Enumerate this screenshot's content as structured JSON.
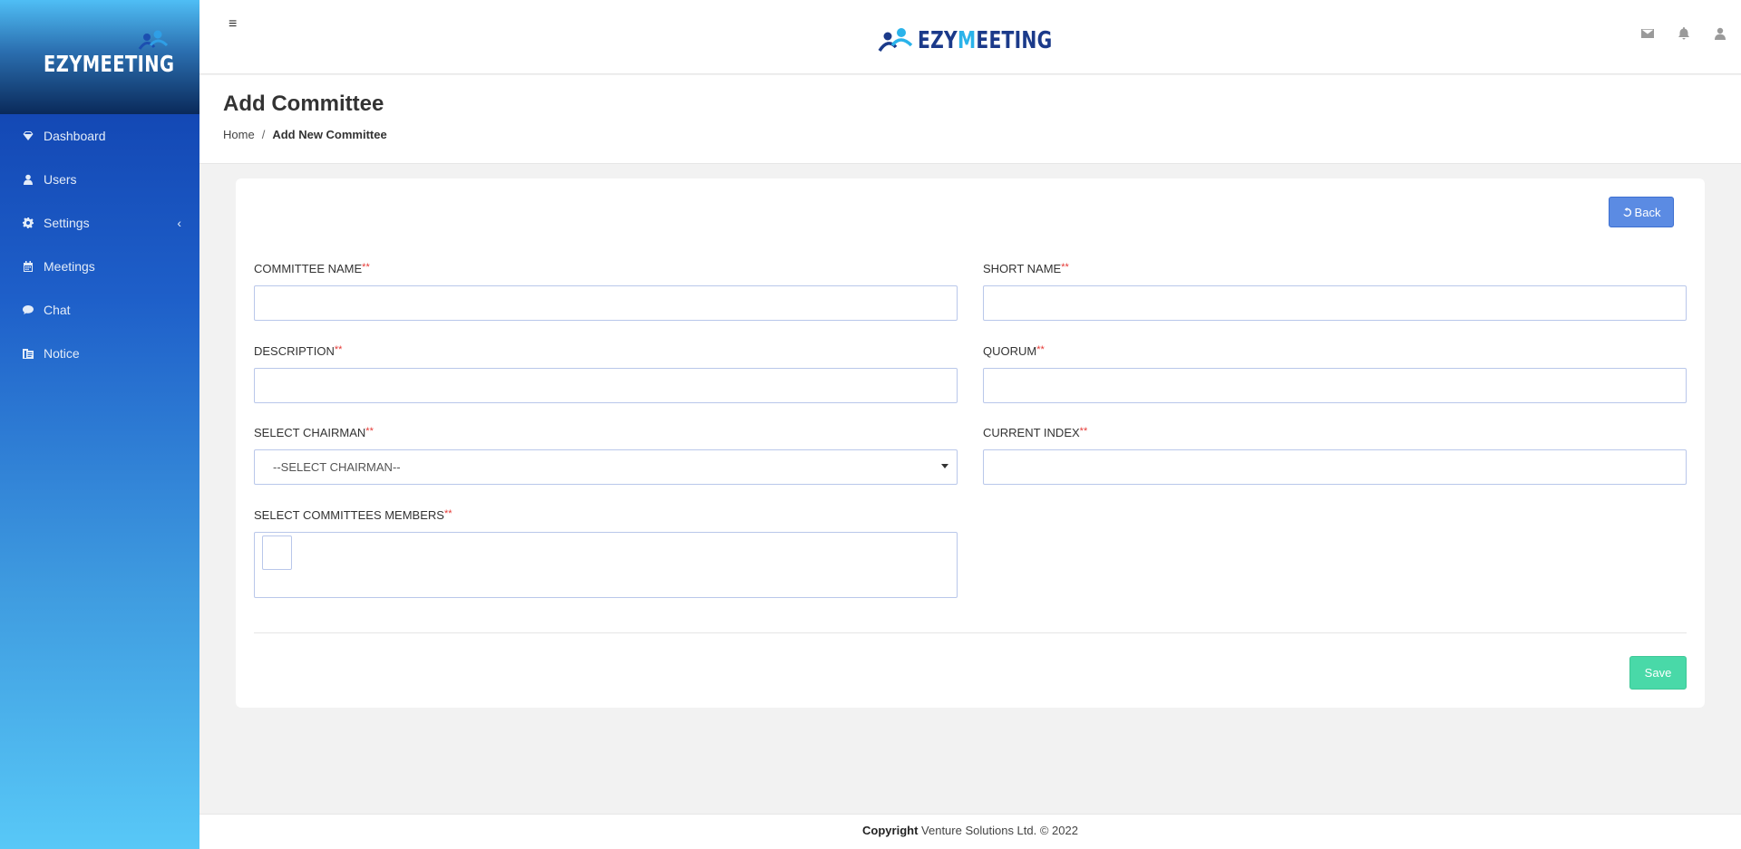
{
  "sidebar": {
    "brand": "EZYMEETING",
    "items": [
      {
        "label": "Dashboard",
        "icon": "diamond-icon"
      },
      {
        "label": "Users",
        "icon": "user-icon"
      },
      {
        "label": "Settings",
        "icon": "gear-icon"
      },
      {
        "label": "Meetings",
        "icon": "calendar-icon"
      },
      {
        "label": "Chat",
        "icon": "chat-icon"
      },
      {
        "label": "Notice",
        "icon": "notice-icon"
      }
    ]
  },
  "header": {
    "logo_main": "EZY",
    "logo_accent": "M",
    "logo_rest": "EETING",
    "icons": [
      "envelope-icon",
      "bell-icon",
      "user-icon"
    ]
  },
  "page": {
    "title": "Add Committee",
    "breadcrumb": {
      "home": "Home",
      "separator": "/",
      "current": "Add New Committee"
    }
  },
  "form": {
    "back_label": "Back",
    "required_mark": "**",
    "fields": {
      "committee_name": {
        "label": "COMMITTEE NAME",
        "value": ""
      },
      "short_name": {
        "label": "SHORT NAME",
        "value": ""
      },
      "description": {
        "label": "DESCRIPTION",
        "value": ""
      },
      "quorum": {
        "label": "QUORUM",
        "value": ""
      },
      "chairman": {
        "label": "SELECT CHAIRMAN",
        "selected": "--SELECT CHAIRMAN--"
      },
      "current_index": {
        "label": "CURRENT INDEX",
        "value": ""
      },
      "members": {
        "label": "SELECT COMMITTEES MEMBERS"
      }
    },
    "save_label": "Save"
  },
  "footer": {
    "bold": "Copyright",
    "text": " Venture Solutions Ltd. © 2022"
  },
  "colors": {
    "back_button": "#5b8be3",
    "save_button": "#49d9a8",
    "required": "#e53935",
    "sidebar_top": "#0d3aa8",
    "sidebar_bottom": "#58c8f7"
  }
}
